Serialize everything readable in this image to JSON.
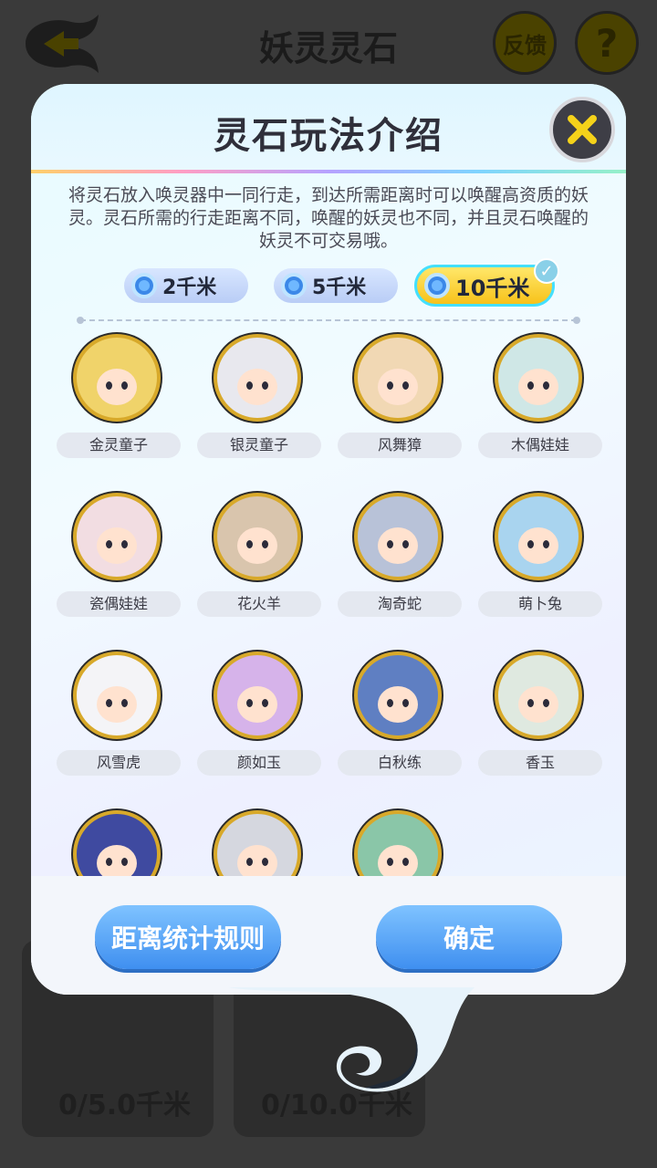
{
  "header": {
    "title": "妖灵灵石",
    "feedback_label": "反馈",
    "help_label": "?"
  },
  "background": {
    "progress_1": "0/5.0千米",
    "progress_2": "0/10.0千米"
  },
  "modal": {
    "title": "灵石玩法介绍",
    "description": "将灵石放入唤灵器中一同行走，到达所需距离时可以唤醒高资质的妖灵。灵石所需的行走距离不同，唤醒的妖灵也不同，并且灵石唤醒的妖灵不可交易哦。",
    "tabs": [
      {
        "label": "2千米",
        "active": false
      },
      {
        "label": "5千米",
        "active": false
      },
      {
        "label": "10千米",
        "active": true
      }
    ],
    "spirits": [
      {
        "name": "金灵童子",
        "ring": "#d8a92a",
        "bg": "#f0d36a"
      },
      {
        "name": "银灵童子",
        "ring": "#d8a92a",
        "bg": "#e8e8ee"
      },
      {
        "name": "风舞獐",
        "ring": "#d8a92a",
        "bg": "#f1d8b4"
      },
      {
        "name": "木偶娃娃",
        "ring": "#d8a92a",
        "bg": "#cfe7e6"
      },
      {
        "name": "瓷偶娃娃",
        "ring": "#d8a92a",
        "bg": "#f2dde2"
      },
      {
        "name": "花火羊",
        "ring": "#d8a92a",
        "bg": "#d9c5ad"
      },
      {
        "name": "淘奇蛇",
        "ring": "#d8a92a",
        "bg": "#b8c2d8"
      },
      {
        "name": "萌卜兔",
        "ring": "#d8a92a",
        "bg": "#a9d4ef"
      },
      {
        "name": "风雪虎",
        "ring": "#d8a92a",
        "bg": "#f4f4f7"
      },
      {
        "name": "颜如玉",
        "ring": "#d8a92a",
        "bg": "#d6b3ea"
      },
      {
        "name": "白秋练",
        "ring": "#d8a92a",
        "bg": "#5f7fc2"
      },
      {
        "name": "香玉",
        "ring": "#d8a92a",
        "bg": "#dfe9e0"
      },
      {
        "name": "",
        "ring": "#d8a92a",
        "bg": "#3f4aa0"
      },
      {
        "name": "",
        "ring": "#d8a92a",
        "bg": "#d5d7df"
      },
      {
        "name": "",
        "ring": "#d8a92a",
        "bg": "#8ac6a8"
      }
    ],
    "buttons": {
      "rules_label": "距离统计规则",
      "confirm_label": "确定"
    }
  }
}
